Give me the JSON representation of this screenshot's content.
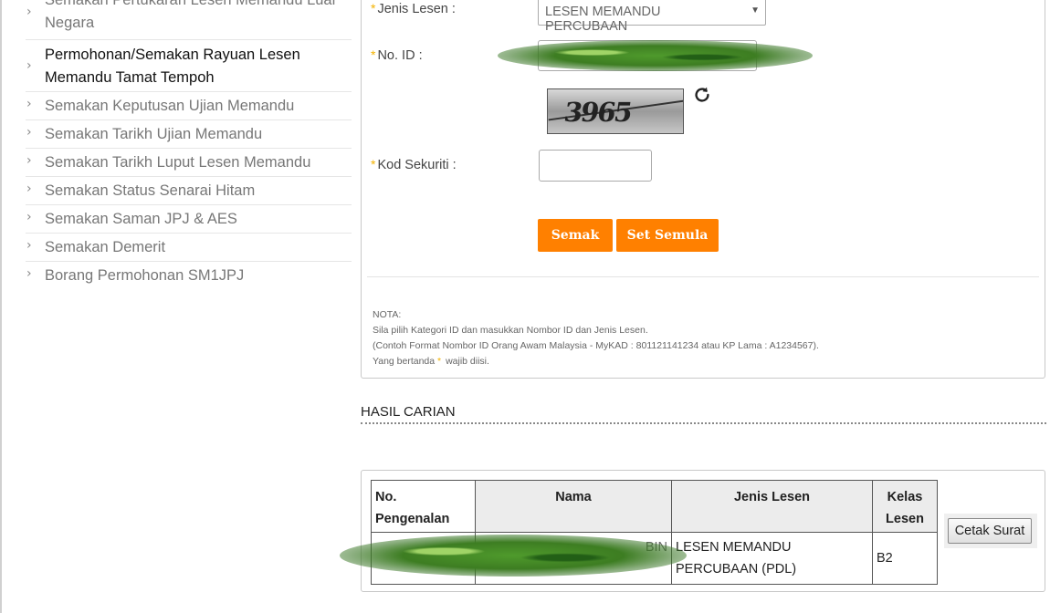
{
  "sidebar": {
    "items": [
      {
        "label": "Semakan Pertukaran Lesen Memandu Luar Negara"
      },
      {
        "label": "Permohonan/Semakan Rayuan Lesen Memandu Tamat Tempoh"
      },
      {
        "label": "Semakan Keputusan Ujian Memandu"
      },
      {
        "label": "Semakan Tarikh Ujian Memandu"
      },
      {
        "label": "Semakan Tarikh Luput Lesen Memandu"
      },
      {
        "label": "Semakan Status Senarai Hitam"
      },
      {
        "label": "Semakan Saman JPJ & AES"
      },
      {
        "label": "Semakan Demerit"
      },
      {
        "label": "Borang Permohonan SM1JPJ"
      }
    ]
  },
  "form": {
    "required_marker": "*",
    "jenis_lesen_label": "Jenis Lesen :",
    "jenis_lesen_value": "LESEN MEMANDU PERCUBAAN",
    "no_id_label": "No. ID :",
    "captcha_text": "3965",
    "kod_label": "Kod Sekuriti :",
    "semak_label": "Semak",
    "reset_label": "Set Semula",
    "nota": {
      "title": "NOTA:",
      "line1": "Sila pilih Kategori ID dan masukkan Nombor ID dan Jenis Lesen.",
      "line2": "(Contoh Format Nombor ID Orang Awam Malaysia - MyKAD : 801121141234 atau KP Lama : A1234567).",
      "line3_pre": "Yang bertanda",
      "line3_post": "wajib diisi."
    }
  },
  "results": {
    "title": "HASIL CARIAN",
    "headers": [
      "No. Pengenalan",
      "Nama",
      "Jenis Lesen",
      "Kelas Lesen"
    ],
    "row": {
      "nama_suffix": "BIN",
      "jenis_lesen": "LESEN MEMANDU PERCUBAAN (PDL)",
      "kelas": "B2"
    },
    "cetak_label": "Cetak Surat"
  },
  "colors": {
    "accent": "#ff8000",
    "required": "#f3b200"
  }
}
